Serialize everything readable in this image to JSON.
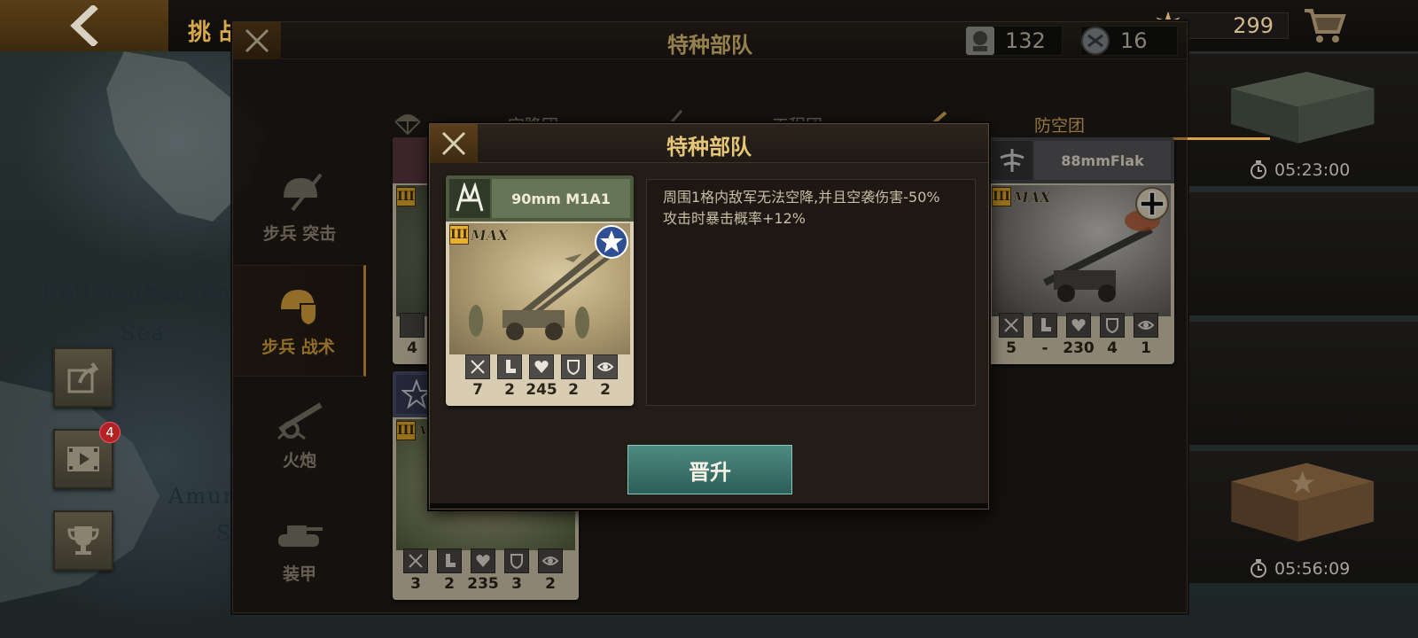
{
  "topbar": {
    "title": "挑 战",
    "coins": "299"
  },
  "map_labels": [
    "Bellinsghausen",
    "Sea",
    "Amundsen",
    "Se"
  ],
  "side_buttons": {
    "video_badge": "4"
  },
  "crates": {
    "timer1": "05:23:00",
    "timer2": "05:56:09"
  },
  "panel": {
    "title": "特种部队",
    "resources": [
      {
        "icon": "general-badge-icon",
        "value": "132"
      },
      {
        "icon": "medal-icon",
        "value": "16"
      }
    ],
    "tabs": [
      {
        "label": "空降团",
        "icon": "parachute-icon"
      },
      {
        "label": "工程团",
        "icon": "shovel-icon"
      },
      {
        "label": "防空团",
        "icon": "aa-gun-icon",
        "active": true
      }
    ],
    "categories": [
      {
        "label": "步兵 突击",
        "icon": "assault-helmet-icon"
      },
      {
        "label": "步兵 战术",
        "icon": "tactics-helmet-icon",
        "active": true
      },
      {
        "label": "火炮",
        "icon": "cannon-icon"
      },
      {
        "label": "装甲",
        "icon": "tank-icon"
      }
    ]
  },
  "cards": {
    "flak": {
      "name": "88mmFlak",
      "rank": "III",
      "max": "MAX",
      "nation": "germany",
      "stats": [
        "5",
        "-",
        "230",
        "4",
        "1"
      ]
    },
    "bottom_left": {
      "rank": "III",
      "max": "MAX",
      "stats": [
        "3",
        "2",
        "235",
        "3",
        "2"
      ]
    },
    "top_left": {
      "stats": [
        "4"
      ]
    }
  },
  "dialog": {
    "title": "特种部队",
    "card": {
      "name": "90mm M1A1",
      "rank": "III",
      "max": "MAX",
      "nation": "usa",
      "stats": [
        "7",
        "2",
        "245",
        "2",
        "2"
      ]
    },
    "description": [
      "周围1格内敌军无法空降,并且空袭伤害-50%",
      "攻击时暴击概率+12%"
    ],
    "promote_label": "晋升"
  },
  "colors": {
    "accent": "#e0b35c",
    "promote": "#3f7a72"
  }
}
